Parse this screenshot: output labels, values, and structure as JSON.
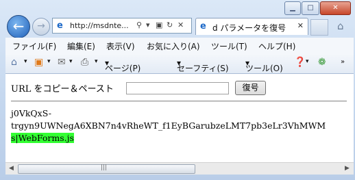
{
  "browser": {
    "address_url": "http://msdnte...",
    "tab_title": "d パラメータを復号"
  },
  "menu": [
    "ファイル(F)",
    "編集(E)",
    "表示(V)",
    "お気に入り(A)",
    "ツール(T)",
    "ヘルプ(H)"
  ],
  "commands": {
    "page": "ページ(P)",
    "safety": "セーフティ(S)",
    "tools": "ツール(O)"
  },
  "page": {
    "label": "URL をコピー＆ペースト",
    "input_value": "",
    "decode_button": "復号",
    "output_line1": "j0VkQxS-",
    "output_line2": "trgyn9UWNegA6XBN7n4vRheWT_f1EyBGarubzeLMT7pb3eLr3VhMWM",
    "output_highlight": "s|WebForms.js"
  },
  "colors": {
    "highlight": "#33ff33",
    "accent": "#1f5fb8"
  }
}
